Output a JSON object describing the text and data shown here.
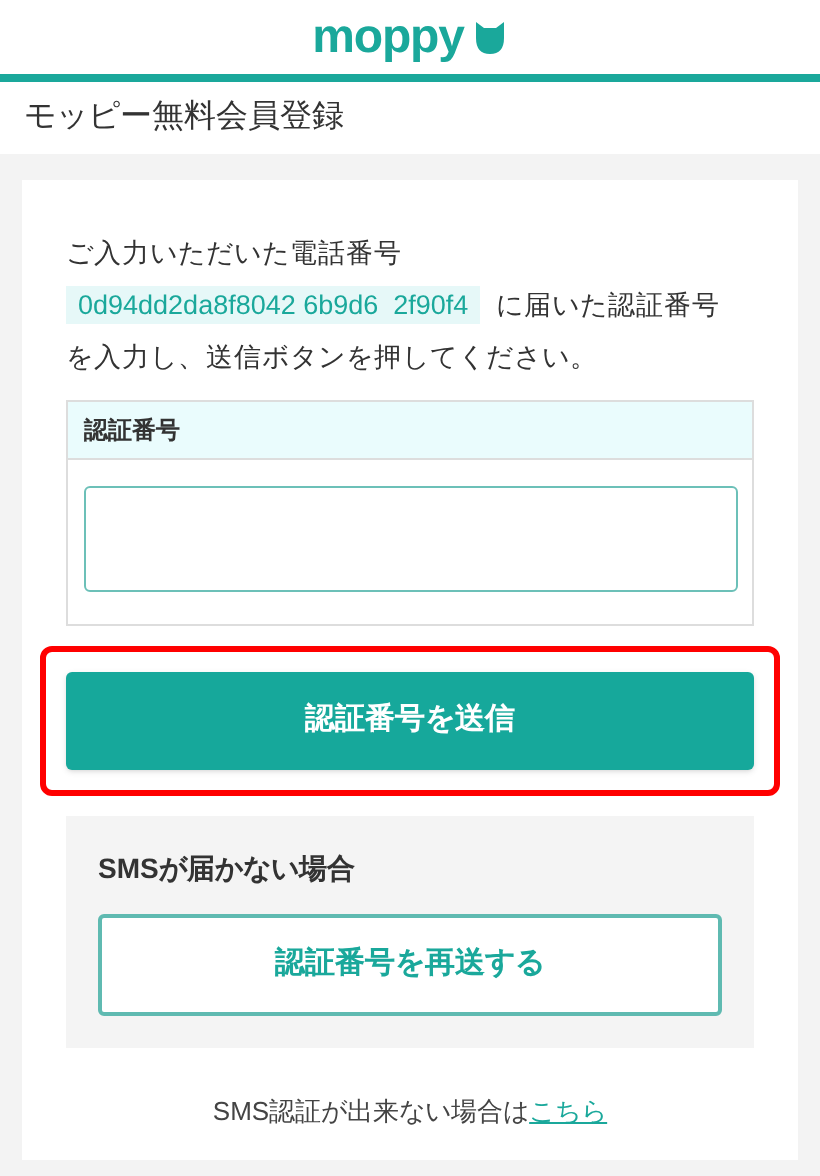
{
  "header": {
    "logo": "moppy"
  },
  "page_title": "モッピー無料会員登録",
  "instructions": {
    "intro": "ご入力いただいた電話番号",
    "phone_number": "0d94dd2da8f8042 6b9d6  2f90f4",
    "rest": "に届いた認証番号を入力し、送信ボタンを押してください。"
  },
  "code_field": {
    "label": "認証番号"
  },
  "submit_button": {
    "label": "認証番号を送信",
    "highlighted": true
  },
  "sms_help": {
    "title": "SMSが届かない場合",
    "resend_button": "認証番号を再送する"
  },
  "footer": {
    "text": "SMS認証が出来ない場合は",
    "link": "こちら"
  }
}
